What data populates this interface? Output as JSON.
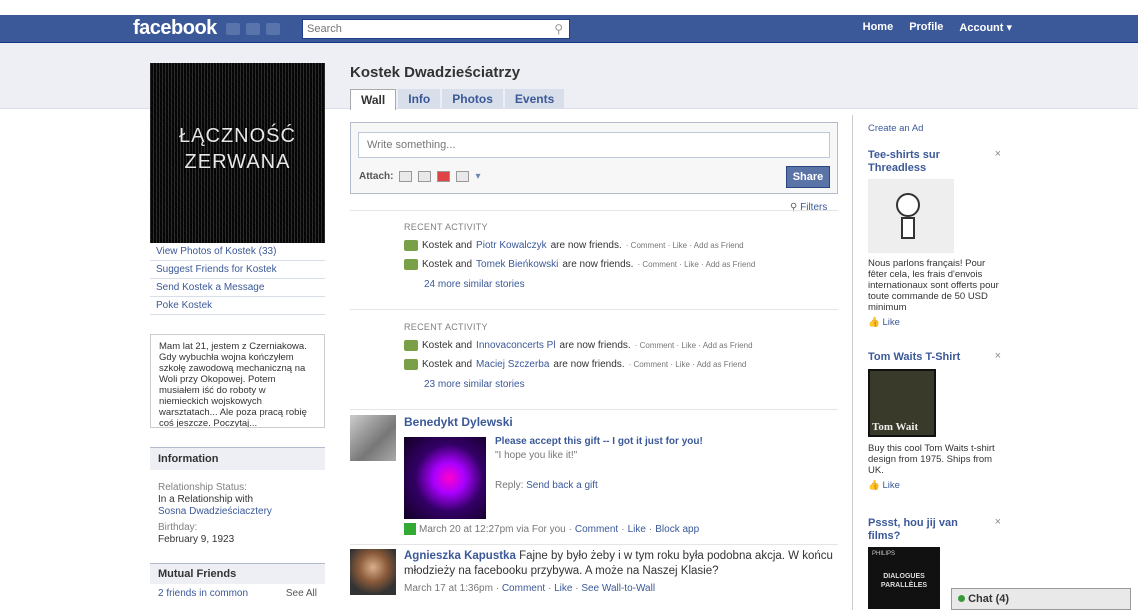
{
  "topbar": {
    "logo": "facebook",
    "search_placeholder": "Search",
    "nav": [
      "Home",
      "Profile",
      "Account ▾"
    ]
  },
  "profile": {
    "name": "Kostek Dwadzieściatrzy",
    "picture_text": [
      "ŁĄCZNOŚĆ",
      "ZERWANA"
    ],
    "tabs": [
      "Wall",
      "Info",
      "Photos",
      "Events"
    ],
    "links": [
      "View Photos of Kostek (33)",
      "Suggest Friends for Kostek",
      "Send Kostek a Message",
      "Poke Kostek"
    ],
    "bio": "Mam lat 21, jestem z Czerniakowa. Gdy wybuchła wojna kończyłem szkołę zawodową mechaniczną na Woli przy Okopowej. Potem musiałem iść do roboty w niemieckich wojskowych warsztatach... Ale poza pracą robię coś jeszcze. Poczytaj...",
    "information": {
      "header": "Information",
      "relationship_label": "Relationship Status:",
      "relationship_value": "In a Relationship with",
      "relationship_partner": "Sosna Dwadzieściacztery",
      "birthday_label": "Birthday:",
      "birthday_value": "February 9, 1923"
    },
    "mutual": {
      "header": "Mutual Friends",
      "count": "2 friends in common",
      "see_all": "See All"
    }
  },
  "composer": {
    "placeholder": "Write something...",
    "attach_label": "Attach:",
    "share": "Share",
    "filters": "Filters"
  },
  "activity": [
    {
      "header": "RECENT ACTIVITY",
      "lines": [
        {
          "pre": "Kostek and ",
          "friend": "Piotr Kowalczyk",
          "post": " are now friends.",
          "actions": "· Comment · Like · Add as Friend"
        },
        {
          "pre": "Kostek and ",
          "friend": "Tomek Bieńkowski",
          "post": " are now friends.",
          "actions": "· Comment · Like · Add as Friend"
        }
      ],
      "more": "24 more similar stories"
    },
    {
      "header": "RECENT ACTIVITY",
      "lines": [
        {
          "pre": "Kostek and ",
          "friend": "Innovaconcerts Pl",
          "post": " are now friends.",
          "actions": "· Comment · Like · Add as Friend"
        },
        {
          "pre": "Kostek and ",
          "friend": "Maciej Szczerba",
          "post": " are now friends.",
          "actions": "· Comment · Like · Add as Friend"
        }
      ],
      "more": "23 more similar stories"
    }
  ],
  "posts": [
    {
      "author": "Benedykt Dylewski",
      "gift_title": "Please accept this gift -- I got it just for you!",
      "gift_quote": "\"I hope you like it!\"",
      "reply_label": "Reply: ",
      "reply_link": "Send back a gift",
      "meta_time": "March 20 at 12:27pm via For you · ",
      "meta_actions": [
        "Comment",
        "Like",
        "Block app"
      ]
    },
    {
      "author": "Agnieszka Kapustka",
      "text": "Fajne by było żeby i w tym roku była podobna akcja. W końcu młodzieży na facebooku przybywa. A może na Naszej Klasie?",
      "meta_time": "March 17 at 1:36pm · ",
      "meta_actions": [
        "Comment",
        "Like",
        "See Wall-to-Wall"
      ]
    }
  ],
  "ads": {
    "create": "Create an Ad",
    "items": [
      {
        "title": "Tee-shirts sur Threadless",
        "body": "Nous parlons français! Pour fêter cela, les frais d'envois internationaux sont offerts pour toute commande de 50 USD minimum",
        "like": "Like"
      },
      {
        "title": "Tom Waits T-Shirt",
        "image_text": "Tom Wait",
        "body": "Buy this cool Tom Waits t-shirt design from 1975. Ships from UK.",
        "like": "Like"
      },
      {
        "title": "Pssst, hou jij van films?",
        "image_text": [
          "PHILIPS",
          "DIALOGUES",
          "PARALLÈLES"
        ]
      }
    ]
  },
  "chat": {
    "label": "Chat (4)"
  }
}
